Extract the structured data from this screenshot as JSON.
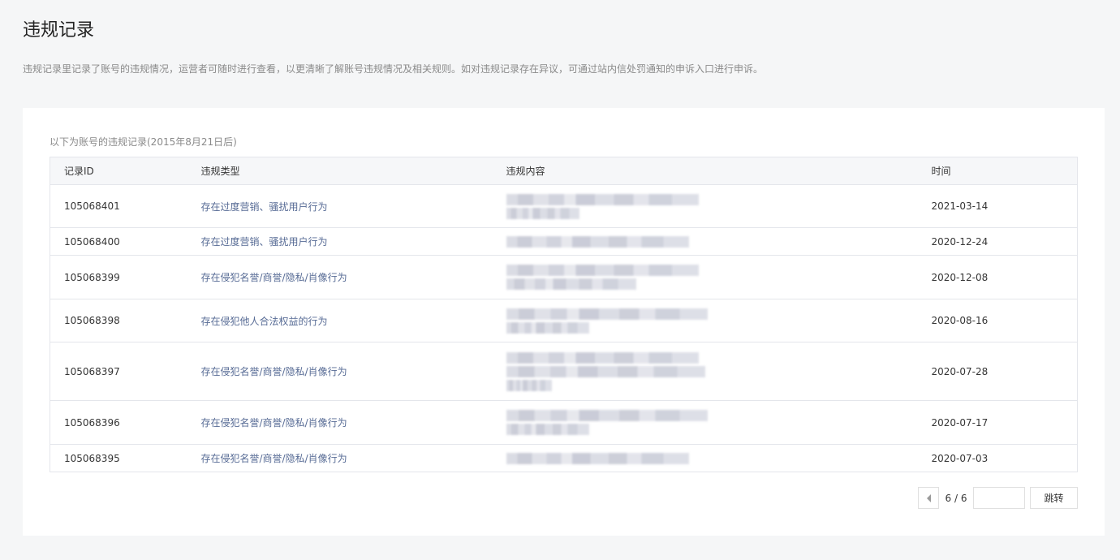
{
  "page": {
    "title": "违规记录",
    "description": "违规记录里记录了账号的违规情况，运营者可随时进行查看，以更清晰了解账号违规情况及相关规则。如对违规记录存在异议，可通过站内信处罚通知的申诉入口进行申诉。"
  },
  "records": {
    "subtitle": "以下为账号的违规记录(2015年8月21日后)",
    "columns": [
      "记录ID",
      "违规类型",
      "违规内容",
      "时间"
    ],
    "rows": [
      {
        "id": "105068401",
        "type": "存在过度营销、骚扰用户行为",
        "date": "2021-03-14"
      },
      {
        "id": "105068400",
        "type": "存在过度营销、骚扰用户行为",
        "date": "2020-12-24"
      },
      {
        "id": "105068399",
        "type": "存在侵犯名誉/商誉/隐私/肖像行为",
        "date": "2020-12-08"
      },
      {
        "id": "105068398",
        "type": "存在侵犯他人合法权益的行为",
        "date": "2020-08-16"
      },
      {
        "id": "105068397",
        "type": "存在侵犯名誉/商誉/隐私/肖像行为",
        "date": "2020-07-28"
      },
      {
        "id": "105068396",
        "type": "存在侵犯名誉/商誉/隐私/肖像行为",
        "date": "2020-07-17"
      },
      {
        "id": "105068395",
        "type": "存在侵犯名誉/商誉/隐私/肖像行为",
        "date": "2020-07-03"
      }
    ]
  },
  "pagination": {
    "prev_icon": "triangle-left-icon",
    "count": "6 / 6",
    "jump_value": "",
    "jump_label": "跳转"
  }
}
